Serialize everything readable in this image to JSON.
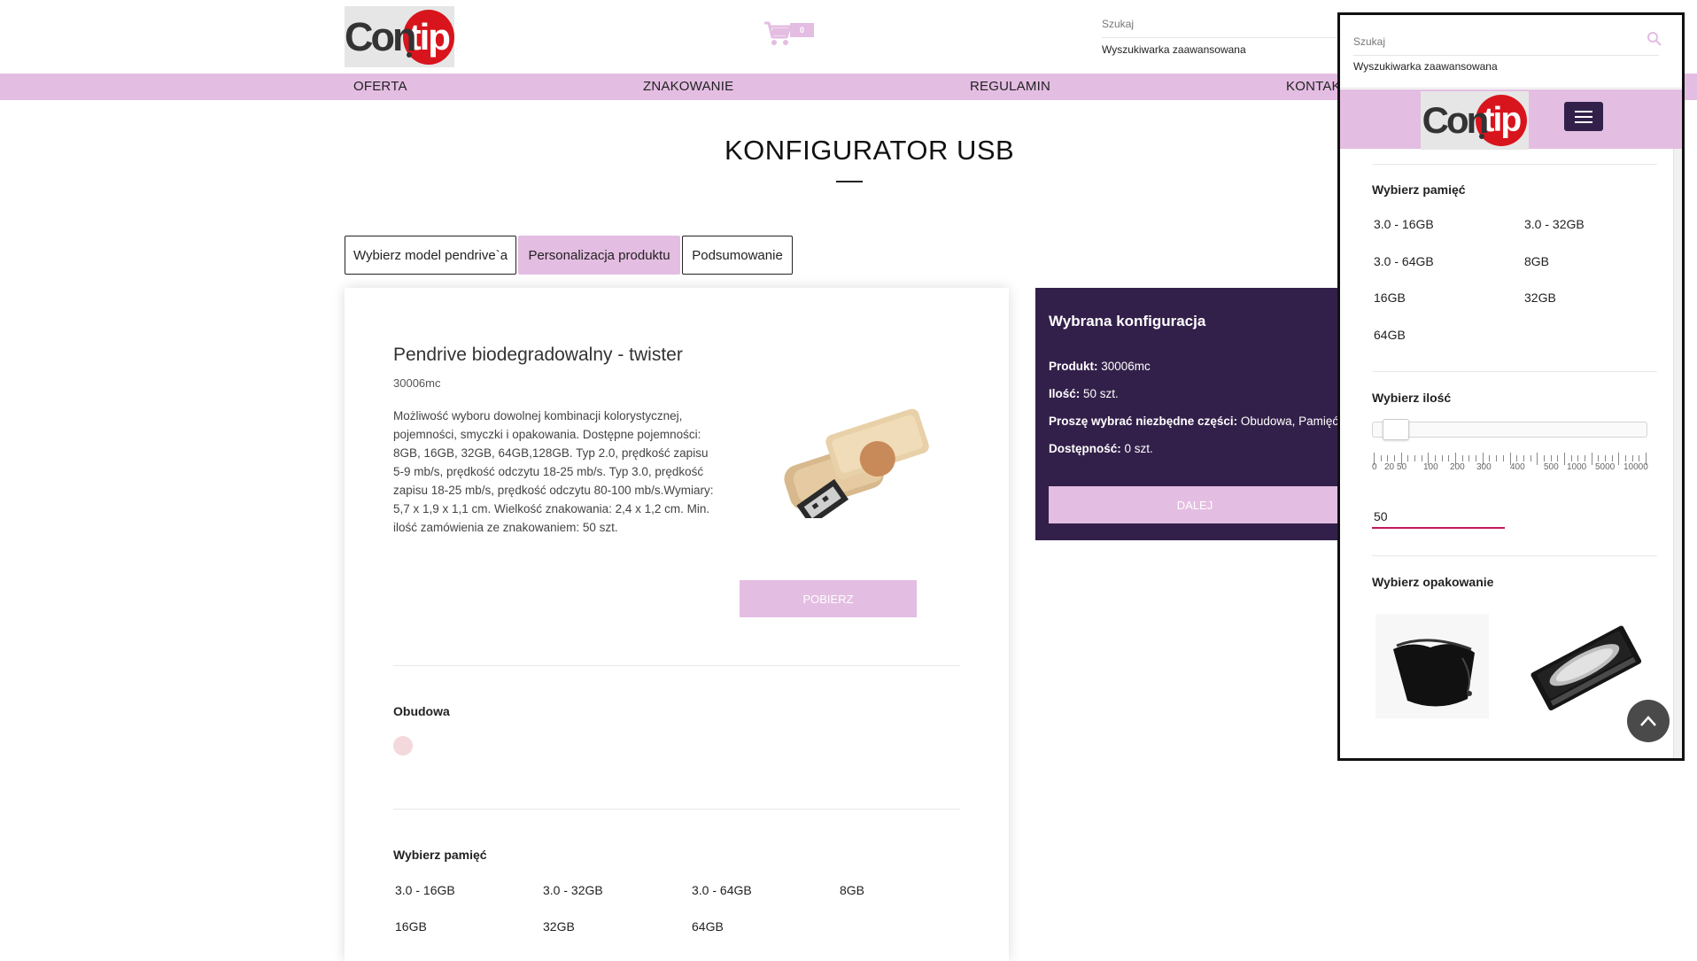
{
  "header": {
    "logo": "Contip",
    "cart_count": "0",
    "search_label": "Szukaj",
    "advanced_search": "Wyszukiwarka zaawansowana"
  },
  "nav": [
    "OFERTA",
    "ZNAKOWANIE",
    "REGULAMIN",
    "KONTAK"
  ],
  "page_title": "KONFIGURATOR USB",
  "tabs": [
    "Wybierz model pendrive`a",
    "Personalizacja produktu",
    "Podsumowanie"
  ],
  "product": {
    "title": "Pendrive biodegradowalny - twister",
    "code": "30006mc",
    "description": "Możliwość wyboru dowolnej kombinacji kolorystycznej, pojemności, smyczki i opakowania. Dostępne pojemności: 8GB, 16GB, 32GB, 64GB,128GB. Typ 2.0, prędkość zapisu 5-9 mb/s, prędkość odczytu 18-25 mb/s. Typ 3.0, prędkość zapisu 18-25 mb/s, prędkość odczytu 80-100 mb/s.Wymiary: 5,7 x 1,9 x 1,1 cm. Wielkość znakowania: 2,4 x 1,2 cm. Min. ilość zamówienia ze znakowaniem: 50 szt.",
    "download_button": "POBIERZ",
    "housing_label": "Obudowa",
    "memory_label": "Wybierz pamięć",
    "memory_options": [
      "3.0 - 16GB",
      "3.0 - 32GB",
      "3.0 - 64GB",
      "8GB",
      "16GB",
      "32GB",
      "64GB"
    ]
  },
  "config": {
    "title": "Wybrana konfiguracja",
    "product_label": "Produkt:",
    "product_value": "30006mc",
    "qty_label": "Ilość:",
    "qty_value": "50 szt.",
    "parts_label": "Proszę wybrać niezbędne części:",
    "parts_value": "Obudowa, Pamięć,",
    "availability_label": "Dostępność:",
    "availability_value": "0 szt.",
    "next_button": "DALEJ"
  },
  "overlay": {
    "search_label": "Szukaj",
    "advanced_search": "Wyszukiwarka zaawansowana",
    "memory_label": "Wybierz pamięć",
    "memory_options": [
      "3.0 - 16GB",
      "3.0 - 32GB",
      "3.0 - 64GB",
      "8GB",
      "16GB",
      "32GB",
      "64GB"
    ],
    "qty_label": "Wybierz ilość",
    "slider_ticks": [
      "0",
      "20",
      "50",
      "100",
      "200",
      "300",
      "400",
      "500",
      "1000",
      "5000",
      "10000"
    ],
    "qty_value": "50",
    "packaging_label": "Wybierz opakowanie"
  },
  "colors": {
    "accent": "#e4bde2",
    "dark": "#33204a",
    "brand_red": "#d8141c"
  }
}
